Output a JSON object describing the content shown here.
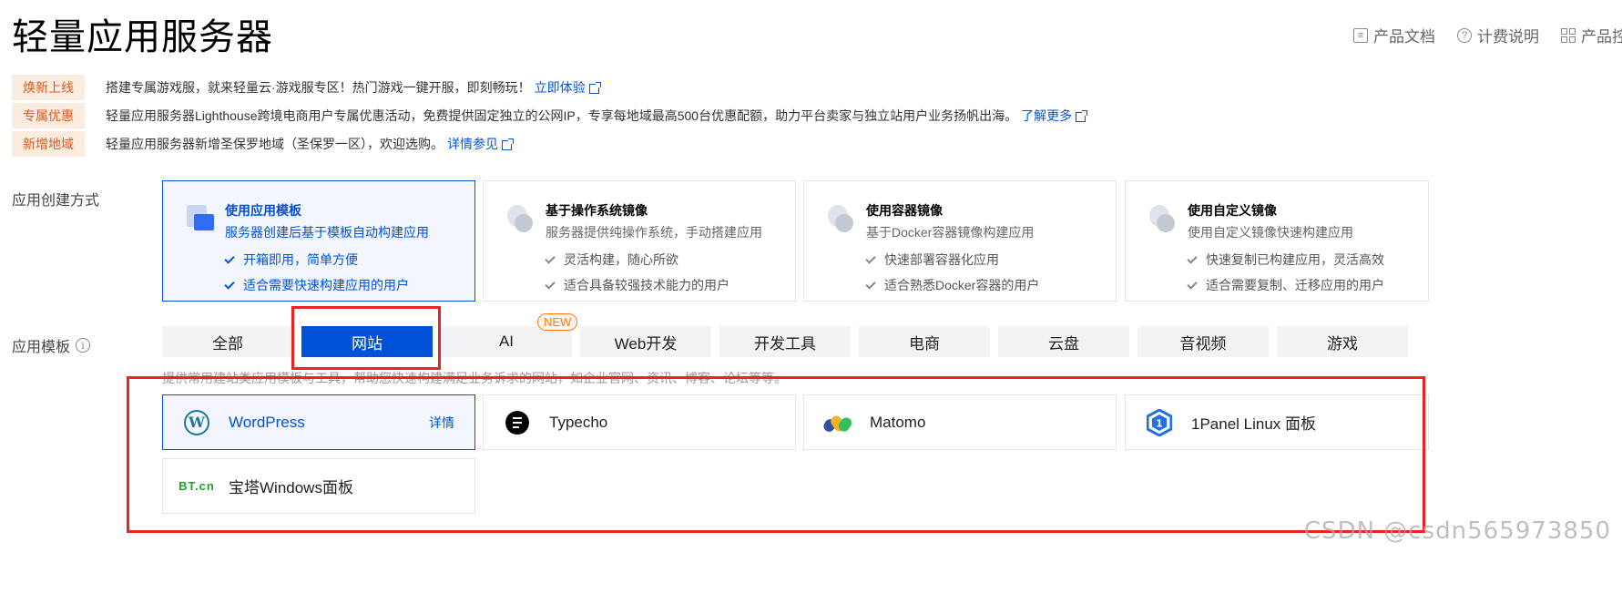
{
  "page": {
    "title": "轻量应用服务器"
  },
  "top_links": [
    {
      "label": "产品文档",
      "icon": "doc-icon"
    },
    {
      "label": "计费说明",
      "icon": "help-circle-icon"
    },
    {
      "label": "产品控制台",
      "icon": "grid-icon"
    }
  ],
  "notices": [
    {
      "tag": "焕新上线",
      "text": "搭建专属游戏服，就来轻量云·游戏服专区！热门游戏一键开服，即刻畅玩！",
      "link": "立即体验"
    },
    {
      "tag": "专属优惠",
      "text": "轻量应用服务器Lighthouse跨境电商用户专属优惠活动，免费提供固定独立的公网IP，专享每地域最高500台优惠配额，助力平台卖家与独立站用户业务扬帆出海。",
      "link": "了解更多"
    },
    {
      "tag": "新增地域",
      "text": "轻量应用服务器新增圣保罗地域（圣保罗一区），欢迎选购。",
      "link": "详情参见"
    }
  ],
  "creation": {
    "label": "应用创建方式",
    "modes": [
      {
        "title": "使用应用模板",
        "subtitle": "服务器创建后基于模板自动构建应用",
        "checks": [
          "开箱即用，简单方便",
          "适合需要快速构建应用的用户"
        ],
        "active": true
      },
      {
        "title": "基于操作系统镜像",
        "subtitle": "服务器提供纯操作系统，手动搭建应用",
        "checks": [
          "灵活构建，随心所欲",
          "适合具备较强技术能力的用户"
        ],
        "active": false
      },
      {
        "title": "使用容器镜像",
        "subtitle": "基于Docker容器镜像构建应用",
        "checks": [
          "快速部署容器化应用",
          "适合熟悉Docker容器的用户"
        ],
        "active": false
      },
      {
        "title": "使用自定义镜像",
        "subtitle": "使用自定义镜像快速构建应用",
        "checks": [
          "快速复制已构建应用，灵活高效",
          "适合需要复制、迁移应用的用户"
        ],
        "active": false
      }
    ]
  },
  "templates": {
    "label": "应用模板",
    "tabs": [
      "全部",
      "网站",
      "AI",
      "Web开发",
      "开发工具",
      "电商",
      "云盘",
      "音视频",
      "游戏"
    ],
    "active_tab": "网站",
    "new_badge": "NEW",
    "description": "提供常用建站类应用模板与工具，帮助您快速构建满足业务诉求的网站，如企业官网、资讯、博客、论坛等等。",
    "items": [
      {
        "name": "WordPress",
        "detail": "详情",
        "icon": "wordpress-icon",
        "active": true
      },
      {
        "name": "Typecho",
        "icon": "typecho-icon"
      },
      {
        "name": "Matomo",
        "icon": "matomo-icon"
      },
      {
        "name": "1Panel Linux 面板",
        "icon": "1panel-icon"
      },
      {
        "name": "宝塔Windows面板",
        "icon": "bt-icon",
        "logo_text": "BT.cn"
      }
    ]
  },
  "watermark": "CSDN @csdn565973850",
  "colors": {
    "primary": "#0052d9",
    "highlight": "#e8261f",
    "tag_bg": "#fcebdf",
    "tag_text": "#d85a1e",
    "new_badge": "#ff7b1a"
  }
}
